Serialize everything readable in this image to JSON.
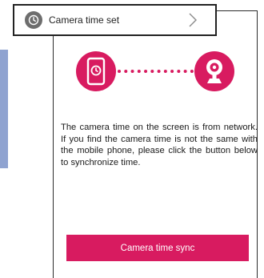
{
  "header": {
    "title": "Camera time set",
    "icon": "clock-icon",
    "chevron_icon": "chevron-right-icon"
  },
  "illustration": {
    "left_icon": "phone-clock-icon",
    "right_icon": "camera-icon",
    "accent_color": "#d81b60"
  },
  "description": "The camera time on the screen is from network. If you find the camera time is not the same with the mobile phone, please click the button below to synchronize time.",
  "sync_button": {
    "label": "Camera time sync",
    "color": "#d81b60"
  }
}
